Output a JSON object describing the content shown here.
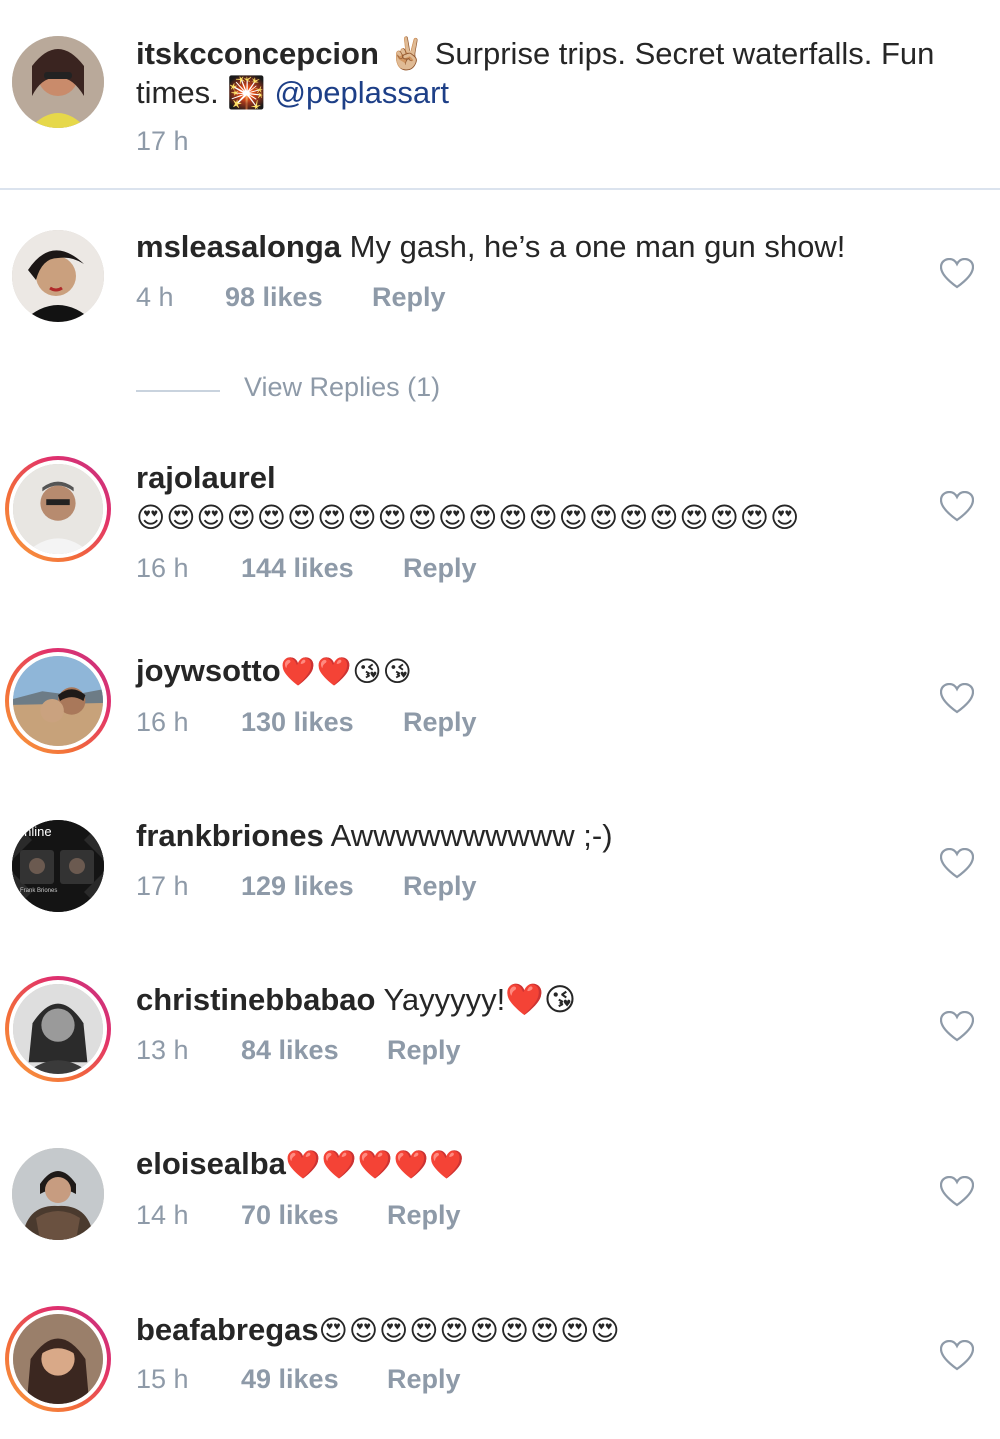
{
  "caption": {
    "username": "itskcconcepcion",
    "text_a": " ✌🏼 Surprise trips. Secret waterfalls. Fun times. 🎇 ",
    "mention": "@peplassart",
    "time": "17 h"
  },
  "comments": [
    {
      "username": "msleasalonga",
      "text": " My gash, he’s a one man gun show!",
      "time": "4 h",
      "likes": "98 likes",
      "reply": "Reply"
    },
    {
      "username": "rajolaurel",
      "text": " 😍😍😍😍😍😍😍😍😍😍😍😍😍😍😍😍😍😍😍😍😍😍",
      "time": "16 h",
      "likes": "144 likes",
      "reply": "Reply"
    },
    {
      "username": "joywsotto",
      "text": " ❤️❤️😘😘",
      "time": "16 h",
      "likes": "130 likes",
      "reply": "Reply"
    },
    {
      "username": "frankbriones",
      "text": " Awwwwwwwwww ;-)",
      "time": "17 h",
      "likes": "129 likes",
      "reply": "Reply",
      "avatar_text": "hinline"
    },
    {
      "username": "christinebbabao",
      "text": " Yayyyyy!❤️😘",
      "time": "13 h",
      "likes": "84 likes",
      "reply": "Reply"
    },
    {
      "username": "eloisealba",
      "text": " ❤️❤️❤️❤️❤️",
      "time": "14 h",
      "likes": "70 likes",
      "reply": "Reply"
    },
    {
      "username": "beafabregas",
      "text": " 😍😍😍😍😍😍😍😍😍😍",
      "time": "15 h",
      "likes": "49 likes",
      "reply": "Reply"
    }
  ],
  "view_replies": "View Replies (1)",
  "icons": {
    "like": "heart-outline-icon"
  },
  "colors": {
    "mention": "#1d3f87",
    "meta": "#8e9aa8",
    "ring_start": "#f9a03f",
    "ring_end": "#c13584"
  }
}
